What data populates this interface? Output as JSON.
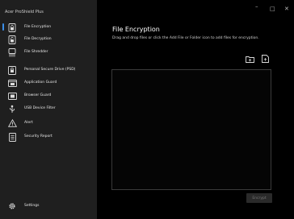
{
  "app": {
    "title": "Acer ProShield Plus"
  },
  "window_controls": {
    "minimize": "–",
    "maximize": "□",
    "close": "✕"
  },
  "sidebar": {
    "items": [
      {
        "label": "File Encryption",
        "icon": "lock-file-icon",
        "active": true
      },
      {
        "label": "File Decryption",
        "icon": "unlock-file-icon",
        "active": false
      },
      {
        "label": "File Shredder",
        "icon": "shredder-icon",
        "active": false
      },
      {
        "label": "Personal Secure Drive (PSD)",
        "icon": "secure-drive-icon",
        "active": false
      },
      {
        "label": "Application Guard",
        "icon": "application-guard-icon",
        "active": false
      },
      {
        "label": "Browser Guard",
        "icon": "browser-guard-icon",
        "active": false
      },
      {
        "label": "USB Device Filter",
        "icon": "usb-icon",
        "active": false
      },
      {
        "label": "Alert",
        "icon": "alert-icon",
        "active": false
      },
      {
        "label": "Security Report",
        "icon": "report-icon",
        "active": false
      }
    ],
    "settings_label": "Settings"
  },
  "main": {
    "title": "File Encryption",
    "description": "Drag and drop files or click the Add File or Folder icon to add files for encryption.",
    "encrypt_label": "Encrypt"
  },
  "colors": {
    "accent": "#3b8ee8",
    "sidebar_bg": "#1f1f1f",
    "main_bg": "#000000"
  }
}
